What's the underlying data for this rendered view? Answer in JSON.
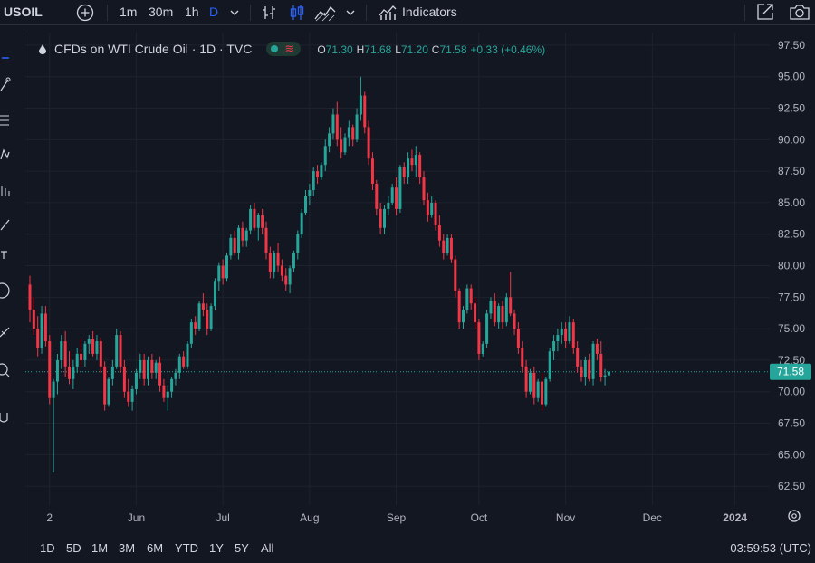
{
  "toolbar": {
    "symbol": "USOIL",
    "intervals": [
      "1m",
      "30m",
      "1h",
      "D"
    ],
    "active_interval": "D",
    "indicators_label": "Indicators"
  },
  "legend": {
    "title": "CFDs on WTI Crude Oil · 1D · TVC",
    "open_label": "O",
    "open": "71.30",
    "high_label": "H",
    "high": "71.68",
    "low_label": "L",
    "low": "71.20",
    "close_label": "C",
    "close": "71.58",
    "change": "+0.33 (+0.46%)"
  },
  "ranges": [
    "1D",
    "5D",
    "1M",
    "3M",
    "6M",
    "YTD",
    "1Y",
    "5Y",
    "All"
  ],
  "clock": "03:59:53 (UTC)",
  "colors": {
    "up": "#26a69a",
    "down": "#f23645",
    "background": "#131722",
    "grid": "#1e222d",
    "price_label": "#26a69a"
  },
  "icons": [
    "add-symbol-icon",
    "bar-style-icon",
    "candles-icon",
    "area-icon",
    "indicators-icon",
    "fullscreen-icon",
    "camera-icon",
    "settings-icon"
  ],
  "chart_data": {
    "type": "candlestick",
    "y_ticks": [
      62.5,
      65,
      67.5,
      70,
      72.5,
      75,
      77.5,
      80,
      82.5,
      85,
      87.5,
      90,
      92.5,
      95,
      97.5
    ],
    "y_tick_labels": [
      "62.50",
      "65.00",
      "67.50",
      "70.00",
      "72.50",
      "75.00",
      "77.50",
      "80.00",
      "82.50",
      "85.00",
      "87.50",
      "90.00",
      "92.50",
      "95.00",
      "97.50"
    ],
    "ylim": [
      61.0,
      98.5
    ],
    "x_tick_labels": [
      "2",
      "Jun",
      "Jul",
      "Aug",
      "Sep",
      "Oct",
      "Nov",
      "Dec",
      "2024"
    ],
    "x_tick_index": [
      5,
      27,
      49,
      71,
      93,
      114,
      136,
      158,
      179
    ],
    "current_price": 71.58,
    "current_price_label": "71.58",
    "candles": [
      [
        78.5,
        79.2,
        75.5,
        76.5
      ],
      [
        76.5,
        77.5,
        74.5,
        75.0
      ],
      [
        75.0,
        76.0,
        72.8,
        73.5
      ],
      [
        73.5,
        76.8,
        73.0,
        76.2
      ],
      [
        76.2,
        76.8,
        73.6,
        74.0
      ],
      [
        74.0,
        74.5,
        69.0,
        69.5
      ],
      [
        69.5,
        71.0,
        63.6,
        70.8
      ],
      [
        70.8,
        73.0,
        69.8,
        72.5
      ],
      [
        72.5,
        74.5,
        71.8,
        74.0
      ],
      [
        74.0,
        74.8,
        71.2,
        72.0
      ],
      [
        72.0,
        73.2,
        70.6,
        71.0
      ],
      [
        71.0,
        72.5,
        70.2,
        72.0
      ],
      [
        72.0,
        73.5,
        71.5,
        73.0
      ],
      [
        73.0,
        74.2,
        72.0,
        72.5
      ],
      [
        72.5,
        74.0,
        72.0,
        73.8
      ],
      [
        73.8,
        74.5,
        73.0,
        74.2
      ],
      [
        74.2,
        74.8,
        72.8,
        73.0
      ],
      [
        73.0,
        74.5,
        72.5,
        74.0
      ],
      [
        74.0,
        74.3,
        71.5,
        72.0
      ],
      [
        72.0,
        72.4,
        68.5,
        69.0
      ],
      [
        69.0,
        71.2,
        68.8,
        71.0
      ],
      [
        71.0,
        72.5,
        70.5,
        72.0
      ],
      [
        72.0,
        75.0,
        71.8,
        74.5
      ],
      [
        74.5,
        74.8,
        71.5,
        72.0
      ],
      [
        72.0,
        72.5,
        69.5,
        70.0
      ],
      [
        70.0,
        71.0,
        68.8,
        69.2
      ],
      [
        69.2,
        70.5,
        68.5,
        70.2
      ],
      [
        70.2,
        71.8,
        69.8,
        71.5
      ],
      [
        71.5,
        73.0,
        71.0,
        72.5
      ],
      [
        72.5,
        73.0,
        70.5,
        71.0
      ],
      [
        71.0,
        72.8,
        70.5,
        72.5
      ],
      [
        72.5,
        73.0,
        71.0,
        71.5
      ],
      [
        71.5,
        72.5,
        71.0,
        72.3
      ],
      [
        72.3,
        72.8,
        70.0,
        70.5
      ],
      [
        70.5,
        71.0,
        69.2,
        69.5
      ],
      [
        69.5,
        70.5,
        68.5,
        70.0
      ],
      [
        70.0,
        71.2,
        69.5,
        71.0
      ],
      [
        71.0,
        71.8,
        70.5,
        71.5
      ],
      [
        71.5,
        73.0,
        71.0,
        72.8
      ],
      [
        72.8,
        73.2,
        71.8,
        72.0
      ],
      [
        72.0,
        74.0,
        71.8,
        73.8
      ],
      [
        73.8,
        75.8,
        73.5,
        75.5
      ],
      [
        75.5,
        76.0,
        74.5,
        75.0
      ],
      [
        75.0,
        77.2,
        74.8,
        77.0
      ],
      [
        77.0,
        77.8,
        76.0,
        76.5
      ],
      [
        76.5,
        77.0,
        74.5,
        75.0
      ],
      [
        75.0,
        77.0,
        74.8,
        76.8
      ],
      [
        76.8,
        79.0,
        76.5,
        78.8
      ],
      [
        78.8,
        80.2,
        78.0,
        80.0
      ],
      [
        80.0,
        80.5,
        78.5,
        79.0
      ],
      [
        79.0,
        81.0,
        78.8,
        80.8
      ],
      [
        80.8,
        82.5,
        80.5,
        82.2
      ],
      [
        82.2,
        82.8,
        80.8,
        81.0
      ],
      [
        81.0,
        83.2,
        80.5,
        83.0
      ],
      [
        83.0,
        83.5,
        81.5,
        82.0
      ],
      [
        82.0,
        83.0,
        81.5,
        82.8
      ],
      [
        82.8,
        84.8,
        82.5,
        84.5
      ],
      [
        84.5,
        85.0,
        82.8,
        83.0
      ],
      [
        83.0,
        84.2,
        82.0,
        84.0
      ],
      [
        84.0,
        84.5,
        82.5,
        83.0
      ],
      [
        83.0,
        83.5,
        80.5,
        81.0
      ],
      [
        81.0,
        81.5,
        79.0,
        79.5
      ],
      [
        79.5,
        81.2,
        79.0,
        81.0
      ],
      [
        81.0,
        81.8,
        79.5,
        80.0
      ],
      [
        80.0,
        80.5,
        78.8,
        79.2
      ],
      [
        79.2,
        79.8,
        78.0,
        78.5
      ],
      [
        78.5,
        80.0,
        77.8,
        79.8
      ],
      [
        79.8,
        81.2,
        79.5,
        81.0
      ],
      [
        81.0,
        82.8,
        80.5,
        82.5
      ],
      [
        82.5,
        84.5,
        82.2,
        84.2
      ],
      [
        84.2,
        86.0,
        84.0,
        85.5
      ],
      [
        85.5,
        86.5,
        84.8,
        86.0
      ],
      [
        86.0,
        87.8,
        85.5,
        87.5
      ],
      [
        87.5,
        88.0,
        86.5,
        87.0
      ],
      [
        87.0,
        88.2,
        86.8,
        88.0
      ],
      [
        88.0,
        90.0,
        87.5,
        89.5
      ],
      [
        89.5,
        91.0,
        89.0,
        90.5
      ],
      [
        90.5,
        92.5,
        90.0,
        92.0
      ],
      [
        92.0,
        93.0,
        89.5,
        90.0
      ],
      [
        90.0,
        91.0,
        88.5,
        89.0
      ],
      [
        89.0,
        90.5,
        88.8,
        90.2
      ],
      [
        90.2,
        91.5,
        89.5,
        91.0
      ],
      [
        91.0,
        91.2,
        89.5,
        90.0
      ],
      [
        90.0,
        92.5,
        89.8,
        92.0
      ],
      [
        92.0,
        95.0,
        91.5,
        93.5
      ],
      [
        93.5,
        93.8,
        90.5,
        91.0
      ],
      [
        91.0,
        91.5,
        88.0,
        88.5
      ],
      [
        88.5,
        89.0,
        86.0,
        86.5
      ],
      [
        86.5,
        86.8,
        84.0,
        84.5
      ],
      [
        84.5,
        85.0,
        82.5,
        83.0
      ],
      [
        83.0,
        84.8,
        82.5,
        84.5
      ],
      [
        84.5,
        85.5,
        84.0,
        85.0
      ],
      [
        85.0,
        86.5,
        84.8,
        86.2
      ],
      [
        86.2,
        87.0,
        84.0,
        84.5
      ],
      [
        84.5,
        88.0,
        84.2,
        87.8
      ],
      [
        87.8,
        88.2,
        86.5,
        87.0
      ],
      [
        87.0,
        89.0,
        86.5,
        88.5
      ],
      [
        88.5,
        89.2,
        87.5,
        88.0
      ],
      [
        88.0,
        89.5,
        87.0,
        88.8
      ],
      [
        88.8,
        89.0,
        86.5,
        87.0
      ],
      [
        87.0,
        87.5,
        84.8,
        85.2
      ],
      [
        85.2,
        85.8,
        83.5,
        84.0
      ],
      [
        84.0,
        85.5,
        83.8,
        85.0
      ],
      [
        85.0,
        85.2,
        82.8,
        83.2
      ],
      [
        83.2,
        84.0,
        81.5,
        82.0
      ],
      [
        82.0,
        82.5,
        80.5,
        81.0
      ],
      [
        81.0,
        82.5,
        80.8,
        82.2
      ],
      [
        82.2,
        82.5,
        80.2,
        80.5
      ],
      [
        80.5,
        80.8,
        77.5,
        78.0
      ],
      [
        78.0,
        78.2,
        75.0,
        75.5
      ],
      [
        75.5,
        76.8,
        75.0,
        76.5
      ],
      [
        76.5,
        78.5,
        76.2,
        78.2
      ],
      [
        78.2,
        78.5,
        76.5,
        77.0
      ],
      [
        77.0,
        77.5,
        75.0,
        75.5
      ],
      [
        75.5,
        75.8,
        72.5,
        73.0
      ],
      [
        73.0,
        74.0,
        72.8,
        73.8
      ],
      [
        73.8,
        76.5,
        73.5,
        76.2
      ],
      [
        76.2,
        77.5,
        75.8,
        77.2
      ],
      [
        77.2,
        77.8,
        75.2,
        75.5
      ],
      [
        75.5,
        77.0,
        75.0,
        76.8
      ],
      [
        76.8,
        77.2,
        75.0,
        75.5
      ],
      [
        75.5,
        77.8,
        75.2,
        77.5
      ],
      [
        77.5,
        79.5,
        76.0,
        76.2
      ],
      [
        76.2,
        76.5,
        74.5,
        75.0
      ],
      [
        75.0,
        75.5,
        73.0,
        73.5
      ],
      [
        73.5,
        74.0,
        71.5,
        72.0
      ],
      [
        72.0,
        72.5,
        69.5,
        70.0
      ],
      [
        70.0,
        71.8,
        69.8,
        71.5
      ],
      [
        71.5,
        72.0,
        69.0,
        69.5
      ],
      [
        69.5,
        71.0,
        69.2,
        70.8
      ],
      [
        70.8,
        71.5,
        68.5,
        69.0
      ],
      [
        69.0,
        71.2,
        68.8,
        71.0
      ],
      [
        71.0,
        73.5,
        70.8,
        73.2
      ],
      [
        73.2,
        74.5,
        72.5,
        74.0
      ],
      [
        74.0,
        75.0,
        73.2,
        74.5
      ],
      [
        74.5,
        75.5,
        73.8,
        75.0
      ],
      [
        75.0,
        75.5,
        73.5,
        74.0
      ],
      [
        74.0,
        76.0,
        73.8,
        75.5
      ],
      [
        75.5,
        75.8,
        73.0,
        73.5
      ],
      [
        73.5,
        74.0,
        71.5,
        72.0
      ],
      [
        72.0,
        72.5,
        70.8,
        71.2
      ],
      [
        71.2,
        72.8,
        70.5,
        72.5
      ],
      [
        72.5,
        73.0,
        70.8,
        71.0
      ],
      [
        71.0,
        74.0,
        70.5,
        73.8
      ],
      [
        73.8,
        74.2,
        72.5,
        73.0
      ],
      [
        73.0,
        74.0,
        70.8,
        71.2
      ],
      [
        71.2,
        71.8,
        70.5,
        71.3
      ],
      [
        71.3,
        71.68,
        71.2,
        71.58
      ]
    ]
  }
}
